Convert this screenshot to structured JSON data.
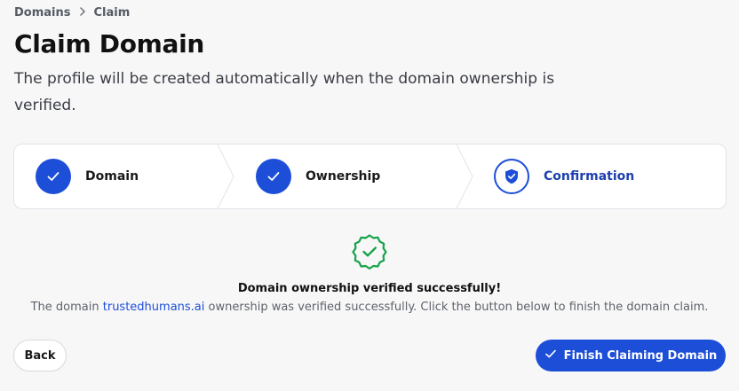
{
  "breadcrumb": {
    "items": [
      "Domains",
      "Claim"
    ]
  },
  "header": {
    "title": "Claim Domain",
    "subtitle": "The profile will be created automatically when the domain ownership is verified."
  },
  "stepper": {
    "steps": [
      {
        "label": "Domain",
        "state": "complete"
      },
      {
        "label": "Ownership",
        "state": "complete"
      },
      {
        "label": "Confirmation",
        "state": "current"
      }
    ]
  },
  "success": {
    "icon": "verified-badge-icon",
    "title": "Domain ownership verified successfully!",
    "desc_prefix": "The domain ",
    "domain": "trustedhumans.ai",
    "desc_suffix": " ownership was verified successfully. Click the button below to finish the domain claim."
  },
  "actions": {
    "back_label": "Back",
    "finish_label": "Finish Claiming Domain"
  },
  "colors": {
    "accent": "#1d4ed8",
    "success": "#16a34a",
    "background": "#f7f7f8"
  }
}
